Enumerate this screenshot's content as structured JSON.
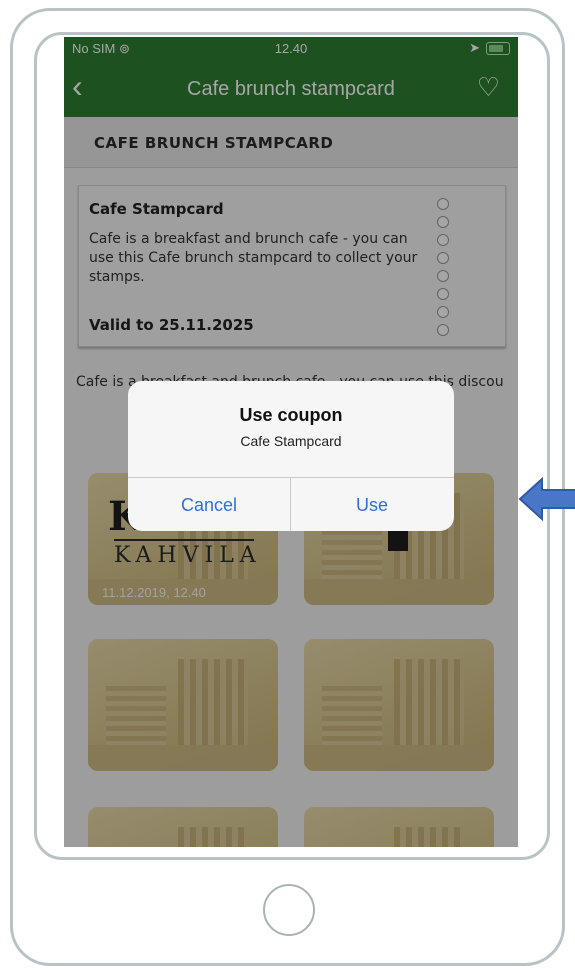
{
  "status_bar": {
    "carrier": "No SIM",
    "time": "12.40"
  },
  "nav": {
    "title": "Cafe brunch stampcard",
    "back_icon": "chevron-left-icon",
    "favorite_icon": "heart-icon"
  },
  "section": {
    "heading": "CAFE BRUNCH STAMPCARD"
  },
  "coupon_card": {
    "title": "Cafe Stampcard",
    "description": "Cafe is a breakfast and brunch cafe - you can use this Cafe brunch stampcard to collect your stamps.",
    "valid": "Valid to 25.11.2025"
  },
  "description": "Cafe is a breakfast and brunch cafe - you can use this discou",
  "stamps": [
    {
      "logo_text": "KAHVILA",
      "date": "11.12.2019, 12.40"
    }
  ],
  "dialog": {
    "title": "Use coupon",
    "subtitle": "Cafe Stampcard",
    "cancel_label": "Cancel",
    "use_label": "Use"
  },
  "colors": {
    "header_green": "#2e7d32",
    "ios_blue": "#2f6fd6",
    "arrow_blue": "#4a76c8"
  }
}
